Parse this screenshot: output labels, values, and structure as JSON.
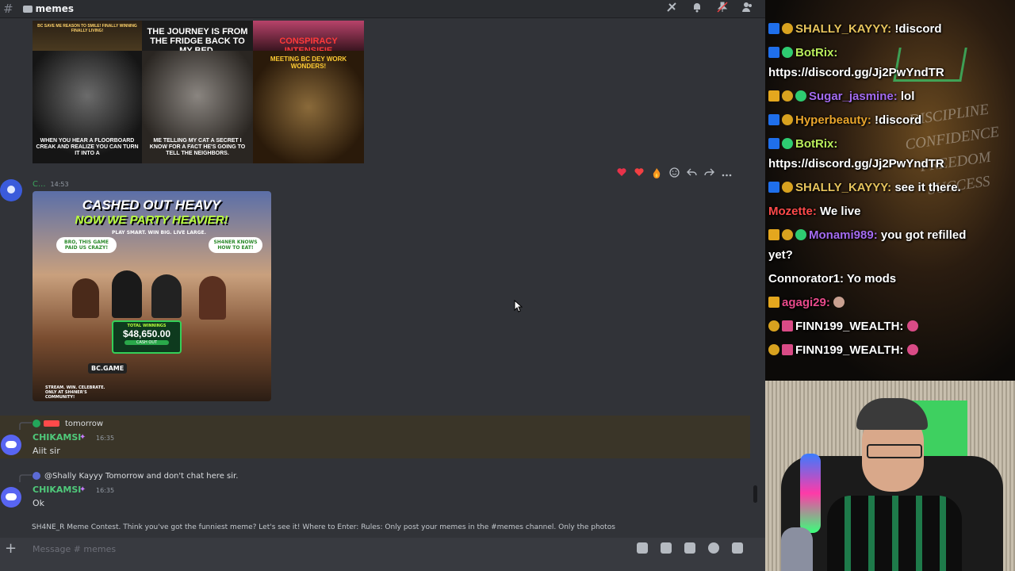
{
  "discord": {
    "channel": {
      "hash": "#",
      "name": "memes"
    },
    "top_icons": [
      "threads-icon",
      "bell-icon",
      "pin-icon",
      "members-icon"
    ],
    "memes_grid": [
      {
        "caption": "BC SAVE ME REASON TO SMILE! FINALLY WINNING FINALLY LIVING!"
      },
      {
        "caption": "THE JOURNEY IS FROM THE FRIDGE BACK TO MY BED."
      },
      {
        "caption": "CONSPIRACY INTENSIFIE"
      },
      {
        "caption": "WHEN YOU HEAR A FLOORBOARD CREAK AND REALIZE YOU CAN TURN IT INTO A"
      },
      {
        "caption": "ME TELLING MY CAT A SECRET I KNOW FOR A FACT HE'S GOING TO TELL THE NEIGHBORS."
      },
      {
        "caption": "MEETING BC DEY WORK WONDERS!"
      }
    ],
    "message1": {
      "author": "C...",
      "time": "14:53",
      "poster": {
        "headline1": "CASHED OUT HEAVY",
        "headline2": "NOW WE PARTY HEAVIER!",
        "tagline": "PLAY SMART. WIN BIG. LIVE LARGE.",
        "bubble_left": "BRO, THIS GAME PAID US CRAZY!",
        "bubble_right": "SH4NER KNOWS HOW TO EAT!",
        "total_label": "TOTAL WINNINGS",
        "total_value": "$48,650.00",
        "cashout": "CASH OUT",
        "brand": "BC.GAME",
        "footer": "STREAM. WIN. CELEBRATE. ONLY AT SH4NER'S COMMUNITY!"
      }
    },
    "message_toolbar": [
      "heart-red-icon",
      "heart-icon",
      "fire-icon",
      "add-reaction-icon",
      "reply-icon",
      "forward-icon",
      "more-icon"
    ],
    "reply1": {
      "line": "tomorrow",
      "user": "CHIKAMSI",
      "time": "16:35",
      "text": "Aiit sir"
    },
    "reply2": {
      "line": "@Shally Kayyy Tomorrow and don't chat here sir.",
      "user": "CHIKAMSI",
      "time": "16:35",
      "text": "Ok"
    },
    "cut_line": "SH4NE_R Meme Contest. Think you've got the funniest meme? Let's see it! Where to Enter: Rules: Only post your memes in the #memes channel. Only the photos",
    "composer": {
      "placeholder": "Message # memes",
      "plus": "+"
    }
  },
  "twitch_chat": [
    {
      "user": "SHALLY_KAYYY:",
      "color": "#e6c35c",
      "msg": "!discord"
    },
    {
      "user": "BotRix:",
      "color": "#b9ec5b",
      "msg": ""
    },
    {
      "user": "",
      "color": "#ffffff",
      "msg": "https://discord.gg/Jj2PwYndTR"
    },
    {
      "user": "Sugar_jasmine:",
      "color": "#a46bf0",
      "msg": "lol"
    },
    {
      "user": "Hyperbeauty:",
      "color": "#e9a52c",
      "msg": "!discord"
    },
    {
      "user": "BotRix:",
      "color": "#b9ec5b",
      "msg": ""
    },
    {
      "user": "",
      "color": "#ffffff",
      "msg": "https://discord.gg/Jj2PwYndTR"
    },
    {
      "user": "SHALLY_KAYYY:",
      "color": "#e6c35c",
      "msg": "see it there."
    },
    {
      "user": "Mozette:",
      "color": "#ff4a4a",
      "msg": "We live"
    },
    {
      "user": "Monami989:",
      "color": "#a46bf0",
      "msg": "you got refilled"
    },
    {
      "user": "",
      "color": "#ffffff",
      "msg": "yet?"
    },
    {
      "user": "Connorator1:",
      "color": "#ffffff",
      "msg": "Yo mods"
    },
    {
      "user": "agagi29:",
      "color": "#e84a8a",
      "msg": ""
    },
    {
      "user": "FINN199_WEALTH:",
      "color": "#ffffff",
      "msg": ""
    },
    {
      "user": "FINN199_WEALTH:",
      "color": "#ffffff",
      "msg": ""
    }
  ],
  "overlay_words": [
    "DISCIPLINE",
    "CONFIDENCE",
    "FREEDOM",
    "SUCCESS"
  ]
}
